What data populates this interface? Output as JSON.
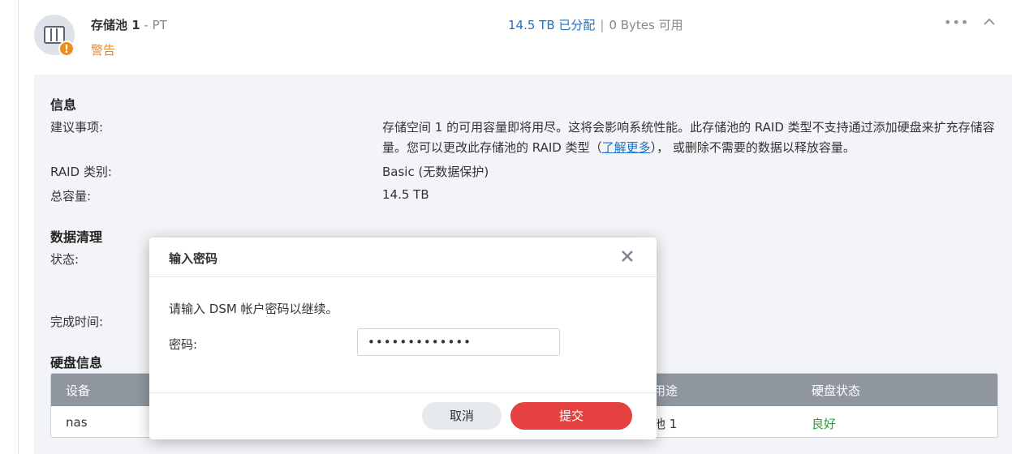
{
  "pool": {
    "name": "存储池 1",
    "subtitle": "- PT",
    "status": "警告",
    "allocated": "14.5 TB 已分配",
    "separator": "|",
    "available": "0 Bytes 可用"
  },
  "info": {
    "section_title": "信息",
    "suggestion_label": "建议事项:",
    "suggestion_text_1": "存储空间 1 的可用容量即将用尽。这将会影响系统性能。此存储池的 RAID 类型不支持通过添加硬盘来扩充存储容量。您可以更改此存储池的 RAID 类型（",
    "suggestion_link": "了解更多",
    "suggestion_text_2": "）， 或删除不需要的数据以释放容量。",
    "raid_label": "RAID 类别:",
    "raid_value": "Basic (无数据保护)",
    "total_label": "总容量:",
    "total_value": "14.5 TB"
  },
  "scrub": {
    "section_title": "数据清理",
    "status_label": "状态:",
    "finish_label": "完成时间:"
  },
  "disks": {
    "section_title": "硬盘信息",
    "columns": {
      "device": "设备",
      "usage": "用途",
      "health": "硬盘状态"
    },
    "rows": [
      {
        "device": "nas",
        "usage": "池 1",
        "health": "良好"
      }
    ]
  },
  "dialog": {
    "title": "输入密码",
    "message": "请输入 DSM 帐户密码以继续。",
    "password_label": "密码:",
    "password_value": "•••••••••••••",
    "cancel_label": "取消",
    "submit_label": "提交"
  },
  "colors": {
    "accent": "#1a73c9",
    "warning": "#e8852b",
    "danger": "#e64141",
    "healthy": "#2e9a3a"
  }
}
